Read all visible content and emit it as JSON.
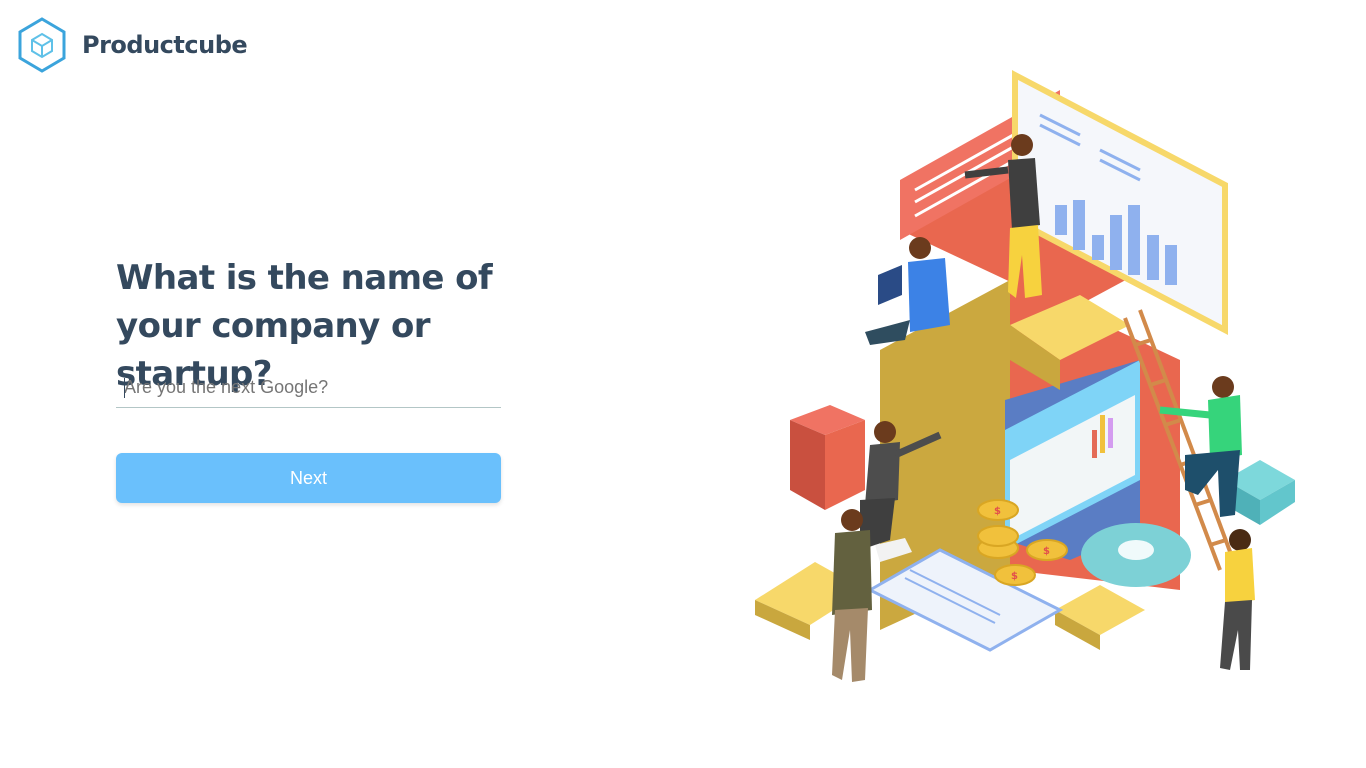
{
  "app": {
    "brand_name": "Productcube"
  },
  "form": {
    "question": "What is the name of your company or startup?",
    "name_placeholder": "Are you the next Google?",
    "name_value": "",
    "next_label": "Next"
  },
  "colors": {
    "heading": "#34495e",
    "button_bg": "#6ac0fc",
    "logo_stroke": "#3ba4dc"
  },
  "illustration": {
    "coin_symbol": "$"
  }
}
